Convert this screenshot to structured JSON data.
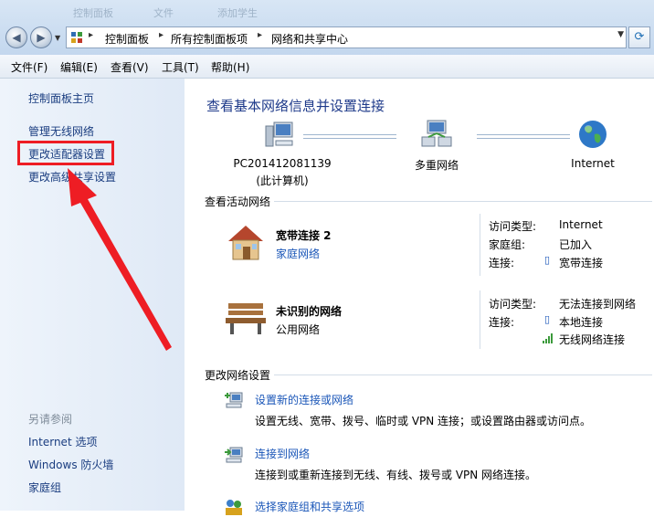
{
  "window": {
    "ghost_titles": [
      "控制面板",
      "文件",
      "添加学生"
    ]
  },
  "address": {
    "breadcrumbs": [
      "控制面板",
      "所有控制面板项",
      "网络和共享中心"
    ]
  },
  "menu": [
    "文件(F)",
    "编辑(E)",
    "查看(V)",
    "工具(T)",
    "帮助(H)"
  ],
  "sidebar": {
    "home": "控制面板主页",
    "links": [
      "管理无线网络",
      "更改适配器设置",
      "更改高级共享设置"
    ],
    "see_also_title": "另请参阅",
    "see_also": [
      "Internet 选项",
      "Windows 防火墙",
      "家庭组"
    ]
  },
  "main": {
    "title": "查看基本网络信息并设置连接",
    "map": {
      "computer_name": "PC201412081139",
      "computer_sub": "(此计算机)",
      "middle": "多重网络",
      "internet": "Internet"
    },
    "active_title": "查看活动网络",
    "networks": [
      {
        "name": "宽带连接  2",
        "type": "家庭网络",
        "access_key": "访问类型:",
        "access_val": "Internet",
        "homegroup_key": "家庭组:",
        "homegroup_val": "已加入",
        "conn_key": "连接:",
        "conn_val": "宽带连接"
      },
      {
        "name": "未识别的网络",
        "type": "公用网络",
        "access_key": "访问类型:",
        "access_val": "无法连接到网络",
        "conn_key": "连接:",
        "conn_val": "本地连接",
        "conn_val2": "无线网络连接"
      }
    ],
    "change_title": "更改网络设置",
    "tasks": [
      {
        "link": "设置新的连接或网络",
        "desc": "设置无线、宽带、拨号、临时或 VPN 连接；或设置路由器或访问点。"
      },
      {
        "link": "连接到网络",
        "desc": "连接到或重新连接到无线、有线、拨号或 VPN 网络连接。"
      },
      {
        "link": "选择家庭组和共享选项"
      }
    ]
  },
  "colors": {
    "link": "#1a56b8",
    "heading": "#1e3a8a",
    "highlight": "#ee1d24"
  }
}
